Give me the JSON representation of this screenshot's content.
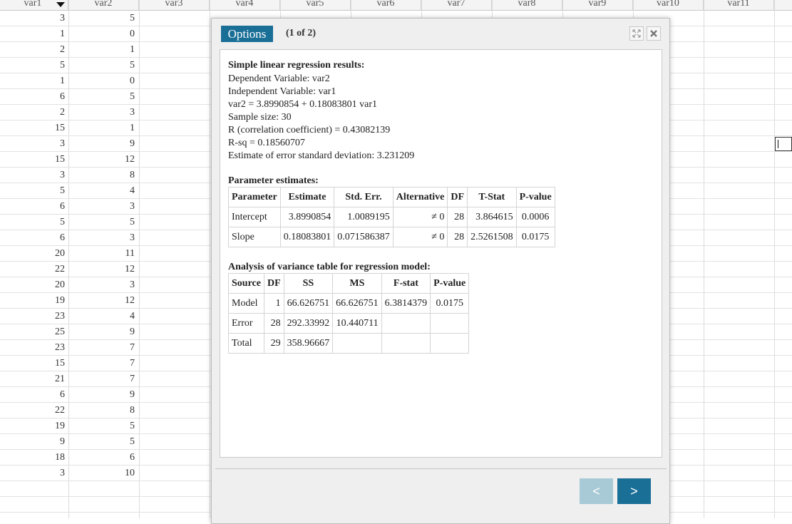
{
  "sheet": {
    "columns": [
      "var1",
      "var2",
      "var3",
      "var4",
      "var5",
      "var6",
      "var7",
      "var8",
      "var9",
      "var10",
      "var11"
    ],
    "rows": [
      [
        "3",
        "5"
      ],
      [
        "1",
        "0"
      ],
      [
        "2",
        "1"
      ],
      [
        "5",
        "5"
      ],
      [
        "1",
        "0"
      ],
      [
        "6",
        "5"
      ],
      [
        "2",
        "3"
      ],
      [
        "15",
        "1"
      ],
      [
        "3",
        "9"
      ],
      [
        "15",
        "12"
      ],
      [
        "3",
        "8"
      ],
      [
        "5",
        "4"
      ],
      [
        "6",
        "3"
      ],
      [
        "5",
        "5"
      ],
      [
        "6",
        "3"
      ],
      [
        "20",
        "11"
      ],
      [
        "22",
        "12"
      ],
      [
        "20",
        "3"
      ],
      [
        "19",
        "12"
      ],
      [
        "23",
        "4"
      ],
      [
        "25",
        "9"
      ],
      [
        "23",
        "7"
      ],
      [
        "15",
        "7"
      ],
      [
        "21",
        "7"
      ],
      [
        "6",
        "9"
      ],
      [
        "22",
        "8"
      ],
      [
        "19",
        "5"
      ],
      [
        "9",
        "5"
      ],
      [
        "18",
        "6"
      ],
      [
        "3",
        "10"
      ]
    ]
  },
  "dialog": {
    "options_label": "Options",
    "page_indicator": "(1 of 2)",
    "prev_label": "<",
    "next_label": ">",
    "results": {
      "title": "Simple linear regression results:",
      "lines": [
        "Dependent Variable: var2",
        "Independent Variable: var1",
        "var2 = 3.8990854 + 0.18083801 var1",
        "Sample size: 30",
        "R (correlation coefficient) = 0.43082139",
        "R-sq = 0.18560707",
        "Estimate of error standard deviation: 3.231209"
      ]
    },
    "param_table": {
      "title": "Parameter estimates:",
      "headers": [
        "Parameter",
        "Estimate",
        "Std. Err.",
        "Alternative",
        "DF",
        "T-Stat",
        "P-value"
      ],
      "rows": [
        [
          "Intercept",
          "3.8990854",
          "1.0089195",
          "≠ 0",
          "28",
          "3.864615",
          "0.0006"
        ],
        [
          "Slope",
          "0.18083801",
          "0.071586387",
          "≠ 0",
          "28",
          "2.5261508",
          "0.0175"
        ]
      ]
    },
    "anova_table": {
      "title": "Analysis of variance table for regression model:",
      "headers": [
        "Source",
        "DF",
        "SS",
        "MS",
        "F-stat",
        "P-value"
      ],
      "rows": [
        [
          "Model",
          "1",
          "66.626751",
          "66.626751",
          "6.3814379",
          "0.0175"
        ],
        [
          "Error",
          "28",
          "292.33992",
          "10.440711",
          "",
          ""
        ],
        [
          "Total",
          "29",
          "358.96667",
          "",
          "",
          ""
        ]
      ]
    },
    "icons": {
      "expand": "expand-icon",
      "close": "close-icon"
    }
  },
  "colors": {
    "accent": "#1a6f97",
    "disabled": "#a8c9d6"
  }
}
